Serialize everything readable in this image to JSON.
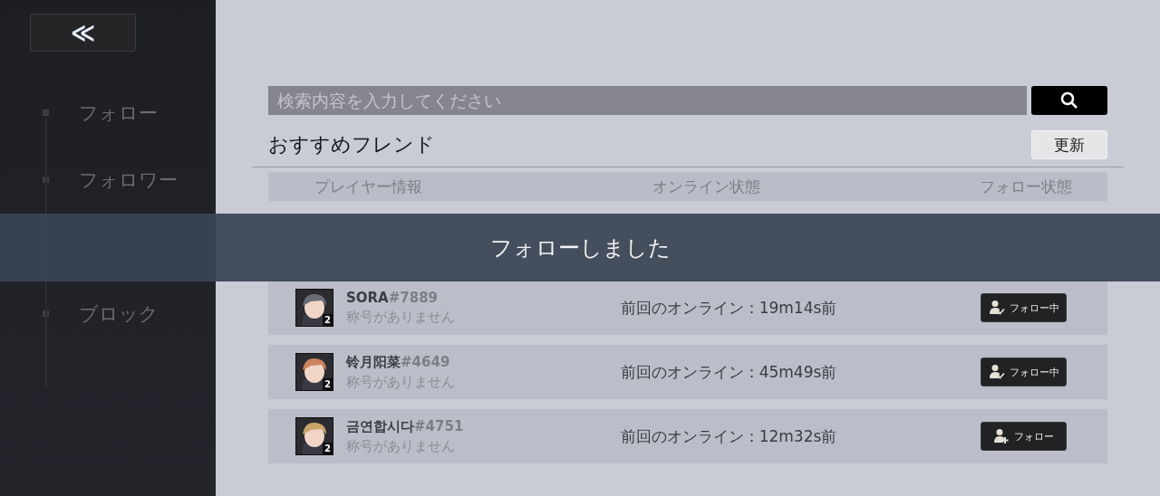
{
  "sidebar": {
    "back_button": "≪",
    "items": [
      {
        "label": "フォロー",
        "selected": false
      },
      {
        "label": "フォロワー",
        "selected": false
      },
      {
        "label": "ブロック",
        "selected": false
      }
    ]
  },
  "search": {
    "placeholder": "検索内容を入力してください"
  },
  "section": {
    "title": "おすすめフレンド",
    "refresh_button": "更新"
  },
  "table": {
    "columns": [
      "プレイヤー情報",
      "オンライン状態",
      "フォロー状態"
    ],
    "rows": [
      {
        "name": "SORA",
        "tag": "#7889",
        "subtitle": "称号がありません",
        "level": "2",
        "status": "前回のオンライン：19m14s前",
        "following": true,
        "button": "フォロー中"
      },
      {
        "name": "铃月阳菜",
        "tag": "#4649",
        "subtitle": "称号がありません",
        "level": "2",
        "status": "前回のオンライン：45m49s前",
        "following": true,
        "button": "フォロー中"
      },
      {
        "name": "금연합시다",
        "tag": "#4751",
        "subtitle": "称号がありません",
        "level": "2",
        "status": "前回のオンライン：12m32s前",
        "following": false,
        "button": "フォロー"
      }
    ]
  },
  "toast": "フォローしました"
}
